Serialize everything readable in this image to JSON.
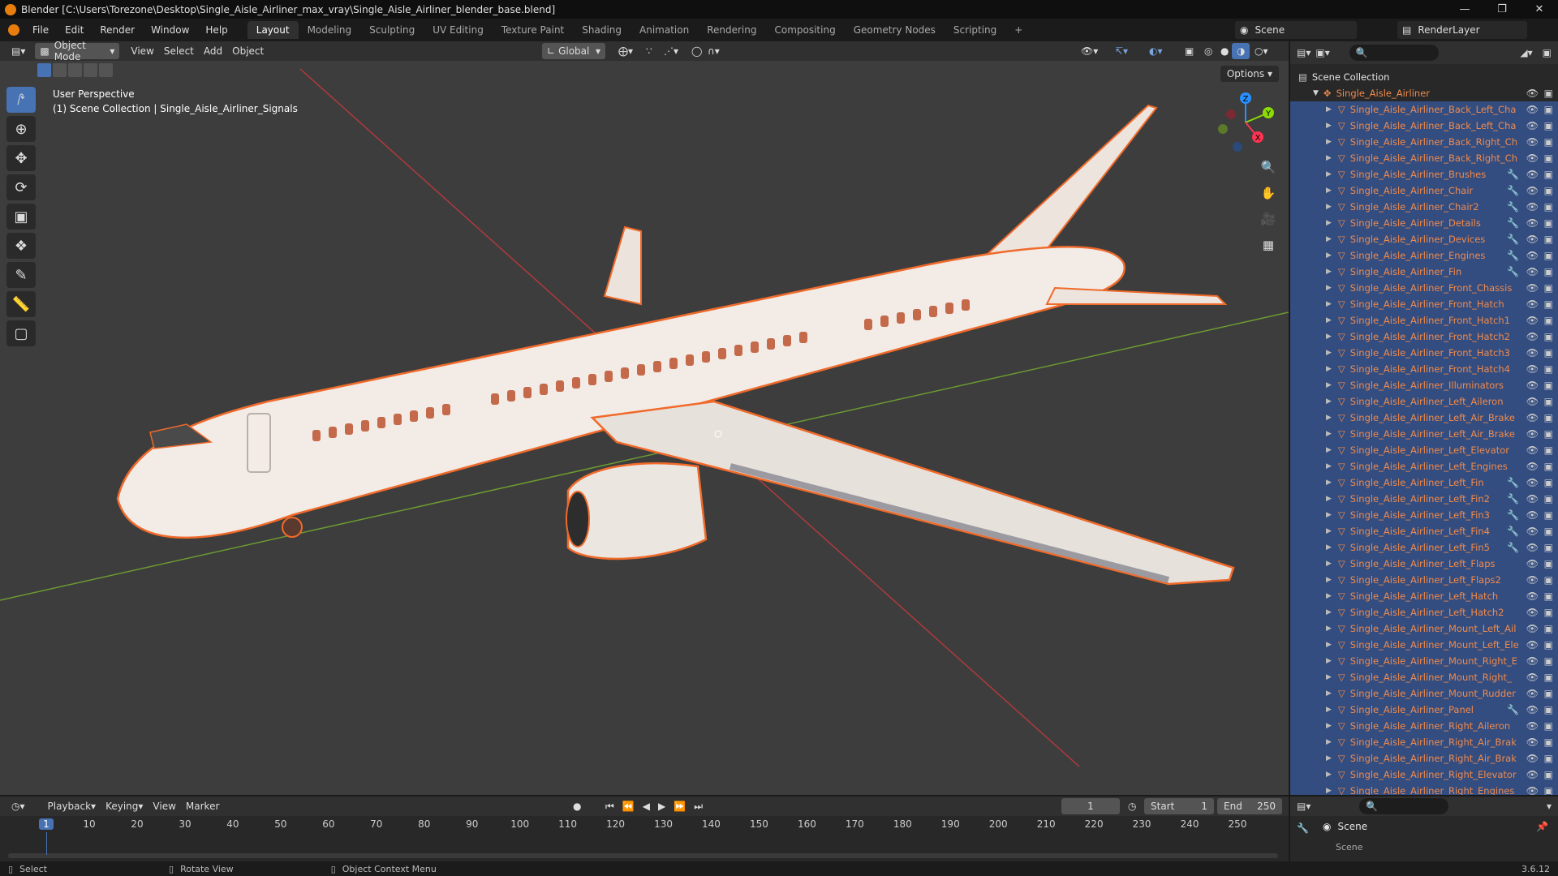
{
  "window": {
    "title": "Blender [C:\\Users\\Torezone\\Desktop\\Single_Aisle_Airliner_max_vray\\Single_Aisle_Airliner_blender_base.blend]"
  },
  "menu": [
    "File",
    "Edit",
    "Render",
    "Window",
    "Help"
  ],
  "workspaces": [
    "Layout",
    "Modeling",
    "Sculpting",
    "UV Editing",
    "Texture Paint",
    "Shading",
    "Animation",
    "Rendering",
    "Compositing",
    "Geometry Nodes",
    "Scripting",
    "+"
  ],
  "scene": {
    "name": "Scene",
    "layer": "RenderLayer"
  },
  "viewport_header": {
    "mode": "Object Mode",
    "menus": [
      "View",
      "Select",
      "Add",
      "Object"
    ],
    "orientation": "Global",
    "options": "Options"
  },
  "viewport": {
    "line1": "User Perspective",
    "line2": "(1) Scene Collection | Single_Aisle_Airliner_Signals"
  },
  "gizmo": {
    "z": "Z",
    "y": "Y",
    "x": "X"
  },
  "outliner": {
    "root": "Scene Collection",
    "parent": "Single_Aisle_Airliner",
    "items": [
      "Single_Aisle_Airliner_Back_Left_Cha",
      "Single_Aisle_Airliner_Back_Left_Cha",
      "Single_Aisle_Airliner_Back_Right_Ch",
      "Single_Aisle_Airliner_Back_Right_Ch",
      "Single_Aisle_Airliner_Brushes",
      "Single_Aisle_Airliner_Chair",
      "Single_Aisle_Airliner_Chair2",
      "Single_Aisle_Airliner_Details",
      "Single_Aisle_Airliner_Devices",
      "Single_Aisle_Airliner_Engines",
      "Single_Aisle_Airliner_Fin",
      "Single_Aisle_Airliner_Front_Chassis",
      "Single_Aisle_Airliner_Front_Hatch",
      "Single_Aisle_Airliner_Front_Hatch1",
      "Single_Aisle_Airliner_Front_Hatch2",
      "Single_Aisle_Airliner_Front_Hatch3",
      "Single_Aisle_Airliner_Front_Hatch4",
      "Single_Aisle_Airliner_Illuminators",
      "Single_Aisle_Airliner_Left_Aileron",
      "Single_Aisle_Airliner_Left_Air_Brake",
      "Single_Aisle_Airliner_Left_Air_Brake",
      "Single_Aisle_Airliner_Left_Elevator",
      "Single_Aisle_Airliner_Left_Engines",
      "Single_Aisle_Airliner_Left_Fin",
      "Single_Aisle_Airliner_Left_Fin2",
      "Single_Aisle_Airliner_Left_Fin3",
      "Single_Aisle_Airliner_Left_Fin4",
      "Single_Aisle_Airliner_Left_Fin5",
      "Single_Aisle_Airliner_Left_Flaps",
      "Single_Aisle_Airliner_Left_Flaps2",
      "Single_Aisle_Airliner_Left_Hatch",
      "Single_Aisle_Airliner_Left_Hatch2",
      "Single_Aisle_Airliner_Mount_Left_Ail",
      "Single_Aisle_Airliner_Mount_Left_Ele",
      "Single_Aisle_Airliner_Mount_Right_E",
      "Single_Aisle_Airliner_Mount_Right_",
      "Single_Aisle_Airliner_Mount_Rudder",
      "Single_Aisle_Airliner_Panel",
      "Single_Aisle_Airliner_Right_Aileron",
      "Single_Aisle_Airliner_Right_Air_Brak",
      "Single_Aisle_Airliner_Right_Air_Brak",
      "Single_Aisle_Airliner_Right_Elevator",
      "Single_Aisle_Airliner_Right_Engines"
    ]
  },
  "timeline": {
    "menus": [
      "Playback",
      "Keying",
      "View",
      "Marker"
    ],
    "current_frame": "1",
    "start_label": "Start",
    "start": "1",
    "end_label": "End",
    "end": "250",
    "ticks": [
      "1",
      "10",
      "20",
      "30",
      "40",
      "50",
      "60",
      "70",
      "80",
      "90",
      "100",
      "110",
      "120",
      "130",
      "140",
      "150",
      "160",
      "170",
      "180",
      "190",
      "200",
      "210",
      "220",
      "230",
      "240",
      "250"
    ]
  },
  "properties": {
    "scene": "Scene",
    "sub": "Scene"
  },
  "statusbar": {
    "select": "Select",
    "rotate": "Rotate View",
    "context": "Object Context Menu",
    "version": "3.6.12"
  },
  "colors": {
    "accent": "#4772b3",
    "selection": "#f06a2a",
    "xaxis": "#ff3352",
    "yaxis": "#8bdc00",
    "zaxis": "#2890ff"
  }
}
